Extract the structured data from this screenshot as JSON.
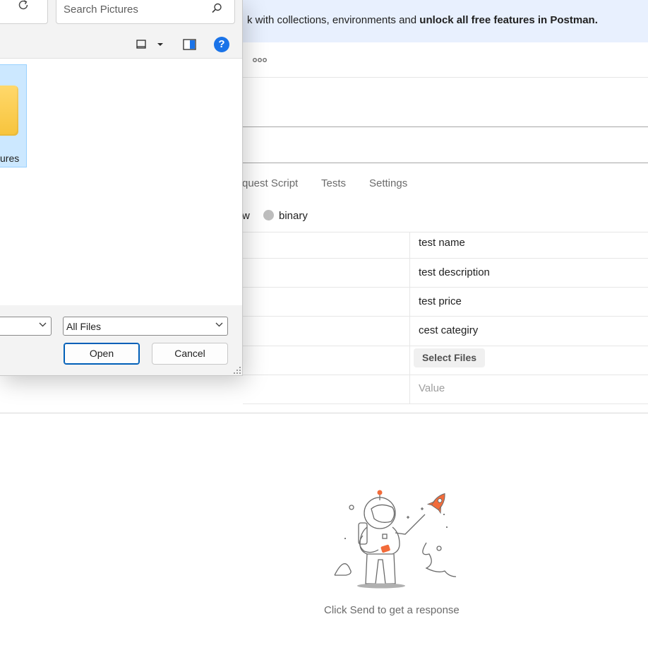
{
  "banner": {
    "text_prefix": "k with collections, environments and ",
    "text_bold": "unlock all free features in Postman."
  },
  "request": {
    "more_icon": "more-horizontal-icon",
    "tabs": [
      "quest Script",
      "Tests",
      "Settings"
    ],
    "body_types": {
      "raw_fragment": "w",
      "binary_label": "binary"
    },
    "form_values": [
      "test name",
      "test description",
      "test price",
      "cest categiry"
    ],
    "select_files_label": "Select Files",
    "value_placeholder": "Value"
  },
  "response": {
    "empty_text": "Click Send to get a response",
    "illustration": "astronaut-rocket-illustration"
  },
  "dialog": {
    "search_placeholder": "Search Pictures",
    "folder_label": "ures",
    "file_type": "All Files",
    "open_label": "Open",
    "cancel_label": "Cancel",
    "help_label": "?",
    "colors": {
      "accent": "#005fb8",
      "selection": "#cce8ff",
      "help": "#1a73e8"
    }
  }
}
